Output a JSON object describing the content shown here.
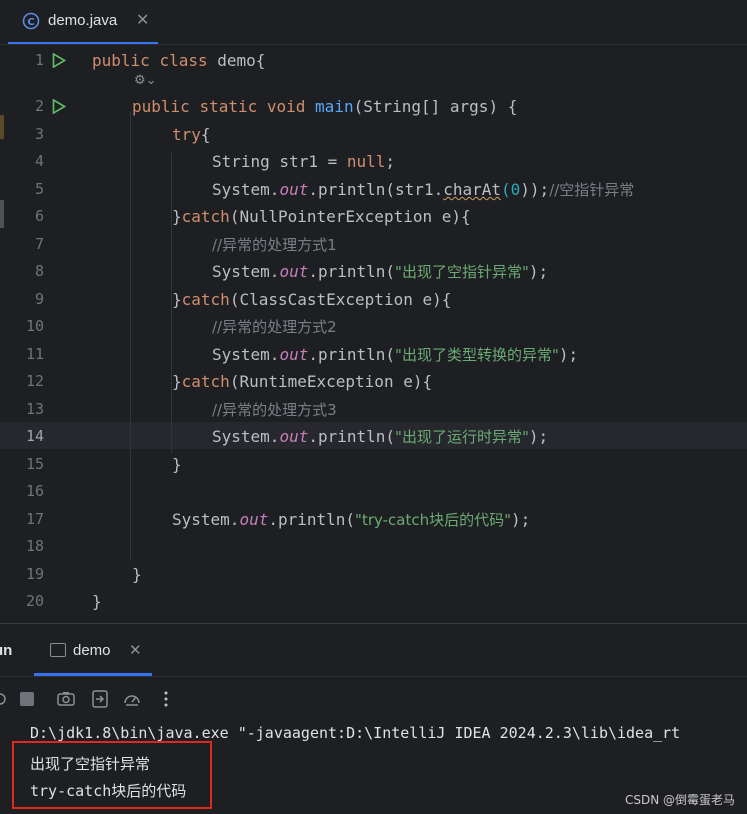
{
  "editor_tab": {
    "filename": "demo.java",
    "close": "✕",
    "icon": "java-class-icon"
  },
  "gutter_lines": [
    "1",
    "2",
    "3",
    "4",
    "5",
    "6",
    "7",
    "8",
    "9",
    "10",
    "11",
    "12",
    "13",
    "14",
    "15",
    "16",
    "17",
    "18",
    "19",
    "20"
  ],
  "code": {
    "l1": {
      "kw1": "public",
      "kw2": "class",
      "rest": " demo{"
    },
    "l2": {
      "kw1": "public",
      "kw2": "static",
      "kw3": "void",
      "fn": "main",
      "rest": "(String[] args) {"
    },
    "l3": {
      "kw": "try",
      "rest": "{"
    },
    "l4": {
      "pre": "String str1 = ",
      "kw": "null",
      "post": ";"
    },
    "l5": {
      "pre": "System.",
      "fld": "out",
      "mid": ".println(str1.",
      "method": "charAt",
      "paren1": "(",
      "num": "0",
      "post": "));",
      "cmt": "//空指针异常"
    },
    "l6": {
      "pre": "}",
      "kw": "catch",
      "rest": "(NullPointerException e){"
    },
    "l7": {
      "cmt": "//异常的处理方式1"
    },
    "l8": {
      "pre": "System.",
      "fld": "out",
      "mid": ".println(",
      "str": "\"出现了空指针异常\"",
      "post": ");"
    },
    "l9": {
      "pre": "}",
      "kw": "catch",
      "rest": "(ClassCastException e){"
    },
    "l10": {
      "cmt": "//异常的处理方式2"
    },
    "l11": {
      "pre": "System.",
      "fld": "out",
      "mid": ".println(",
      "str": "\"出现了类型转换的异常\"",
      "post": ");"
    },
    "l12": {
      "pre": "}",
      "kw": "catch",
      "rest": "(RuntimeException e){"
    },
    "l13": {
      "cmt": "//异常的处理方式3"
    },
    "l14": {
      "pre": "System.",
      "fld": "out",
      "mid": ".println(",
      "str": "\"出现了运行时异常\"",
      "post": ");"
    },
    "l15": {
      "text": "}"
    },
    "l17": {
      "pre": "System.",
      "fld": "out",
      "mid": ".println(",
      "str": "\"try-catch块后的代码\"",
      "post": ");"
    },
    "l19": {
      "text": "}"
    },
    "l20": {
      "text": "}"
    }
  },
  "run_panel": {
    "run_label": "un",
    "tab_label": "demo",
    "tab_close": "✕",
    "toolbar_icons": [
      "rerun-icon",
      "stop-icon",
      "camera-icon",
      "exit-icon",
      "speedometer-icon",
      "more-icon"
    ],
    "console_lines": [
      "D:\\jdk1.8\\bin\\java.exe \"-javaagent:D:\\IntelliJ IDEA 2024.2.3\\lib\\idea_rt",
      "出现了空指针异常",
      "try-catch块后的代码"
    ]
  },
  "watermark": "CSDN @倒霉蛋老马",
  "colors": {
    "background": "#1e1f22",
    "keyword": "#cf8e6d",
    "function": "#56a8f5",
    "field": "#c77dbb",
    "string": "#6aab73",
    "number": "#2aacb8",
    "comment": "#7a7e85",
    "accent": "#3574f0",
    "highlight_box": "#e0281e",
    "run_gutter": "#5fb865"
  }
}
